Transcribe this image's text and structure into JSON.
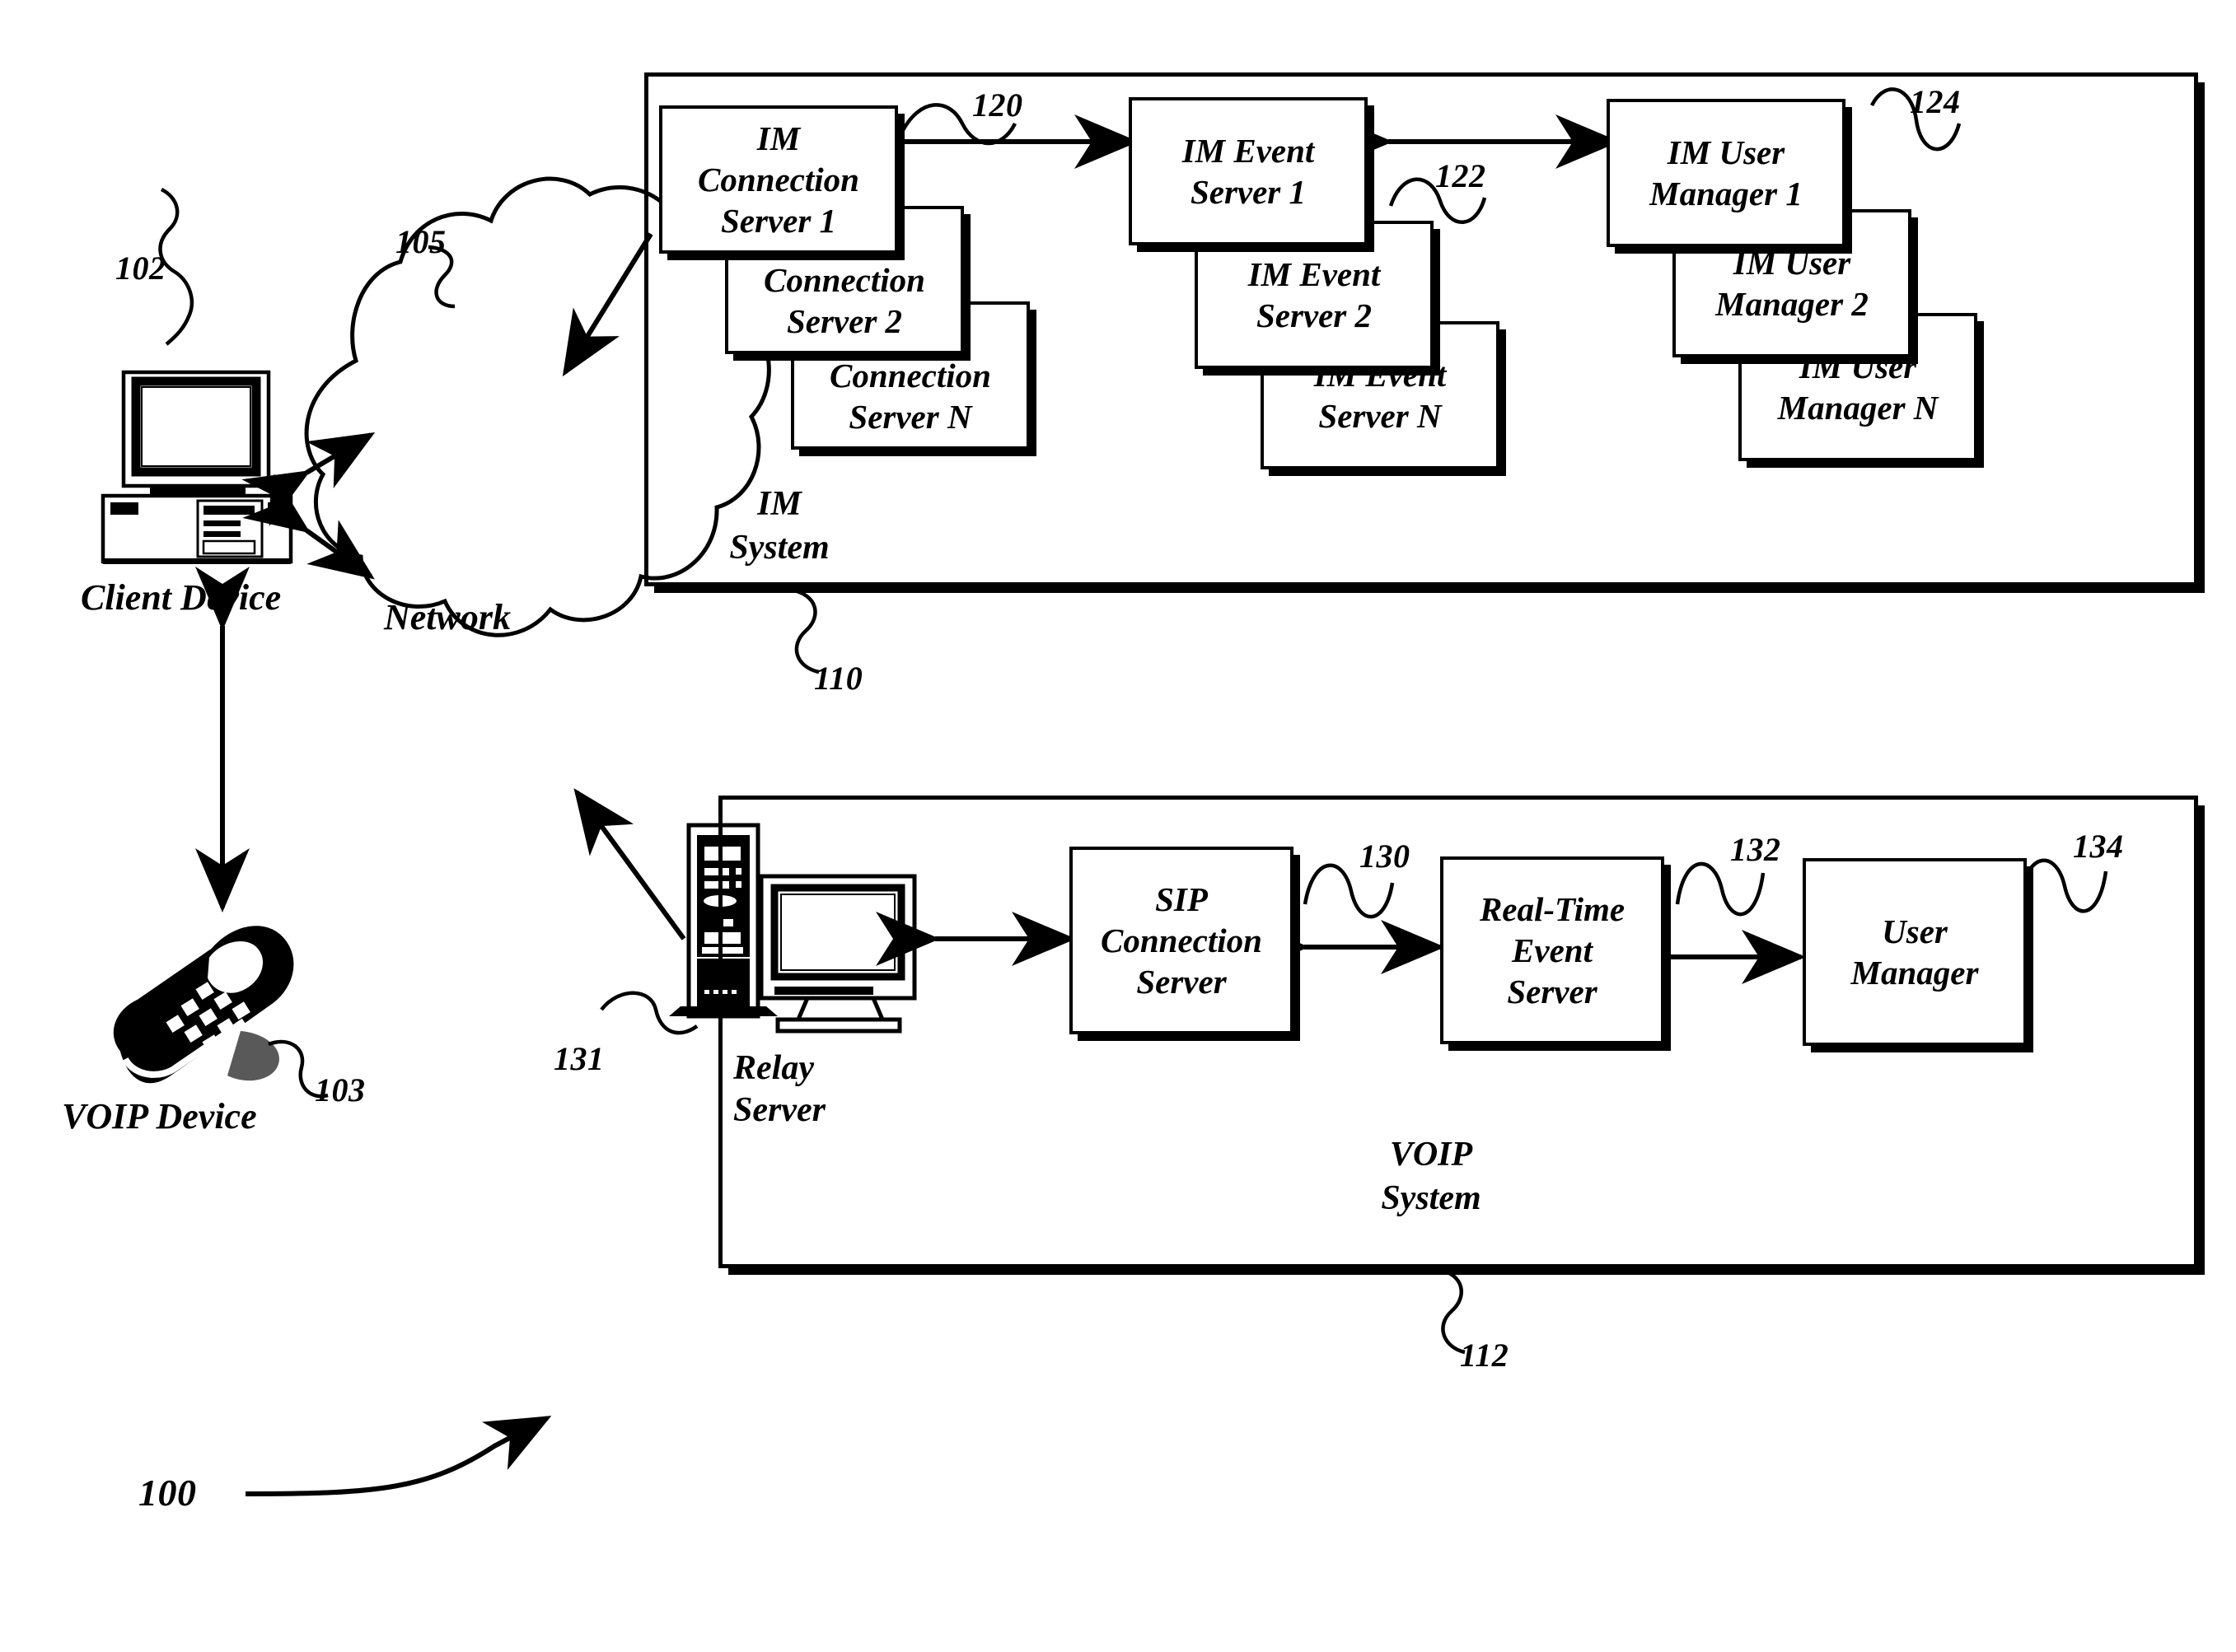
{
  "figure": {
    "overall_ref": "100"
  },
  "devices": {
    "client": {
      "label": "Client Device",
      "ref": "102",
      "icon": "desktop-computer-icon"
    },
    "voip": {
      "label": "VOIP Device",
      "ref": "103",
      "icon": "mobile-phone-icon"
    },
    "relay": {
      "label": "Relay\nServer",
      "ref": "131",
      "icon": "server-tower-and-monitor-icon"
    }
  },
  "network": {
    "label": "Network",
    "ref": "105",
    "icon": "cloud-icon"
  },
  "im_system": {
    "label": "IM\nSystem",
    "ref": "110",
    "groups": [
      {
        "name": "im-connection-server-stack",
        "ref": "120",
        "boxes": [
          {
            "label": "IM\nConnection\nServer 1"
          },
          {
            "label": "IM\nConnection\nServer 2"
          },
          {
            "label": "IM\nConnection\nServer N"
          }
        ]
      },
      {
        "name": "im-event-server-stack",
        "ref": "122",
        "boxes": [
          {
            "label": "IM Event\nServer 1"
          },
          {
            "label": "IM Event\nServer 2"
          },
          {
            "label": "IM Event\nServer N"
          }
        ]
      },
      {
        "name": "im-user-manager-stack",
        "ref": "124",
        "boxes": [
          {
            "label": "IM User\nManager 1"
          },
          {
            "label": "IM User\nManager 2"
          },
          {
            "label": "IM User\nManager N"
          }
        ]
      }
    ]
  },
  "voip_system": {
    "label": "VOIP\nSystem",
    "ref": "112",
    "boxes": [
      {
        "label": "SIP\nConnection\nServer",
        "ref": "130"
      },
      {
        "label": "Real-Time\nEvent\nServer",
        "ref": "132"
      },
      {
        "label": "User\nManager",
        "ref": "134"
      }
    ]
  }
}
